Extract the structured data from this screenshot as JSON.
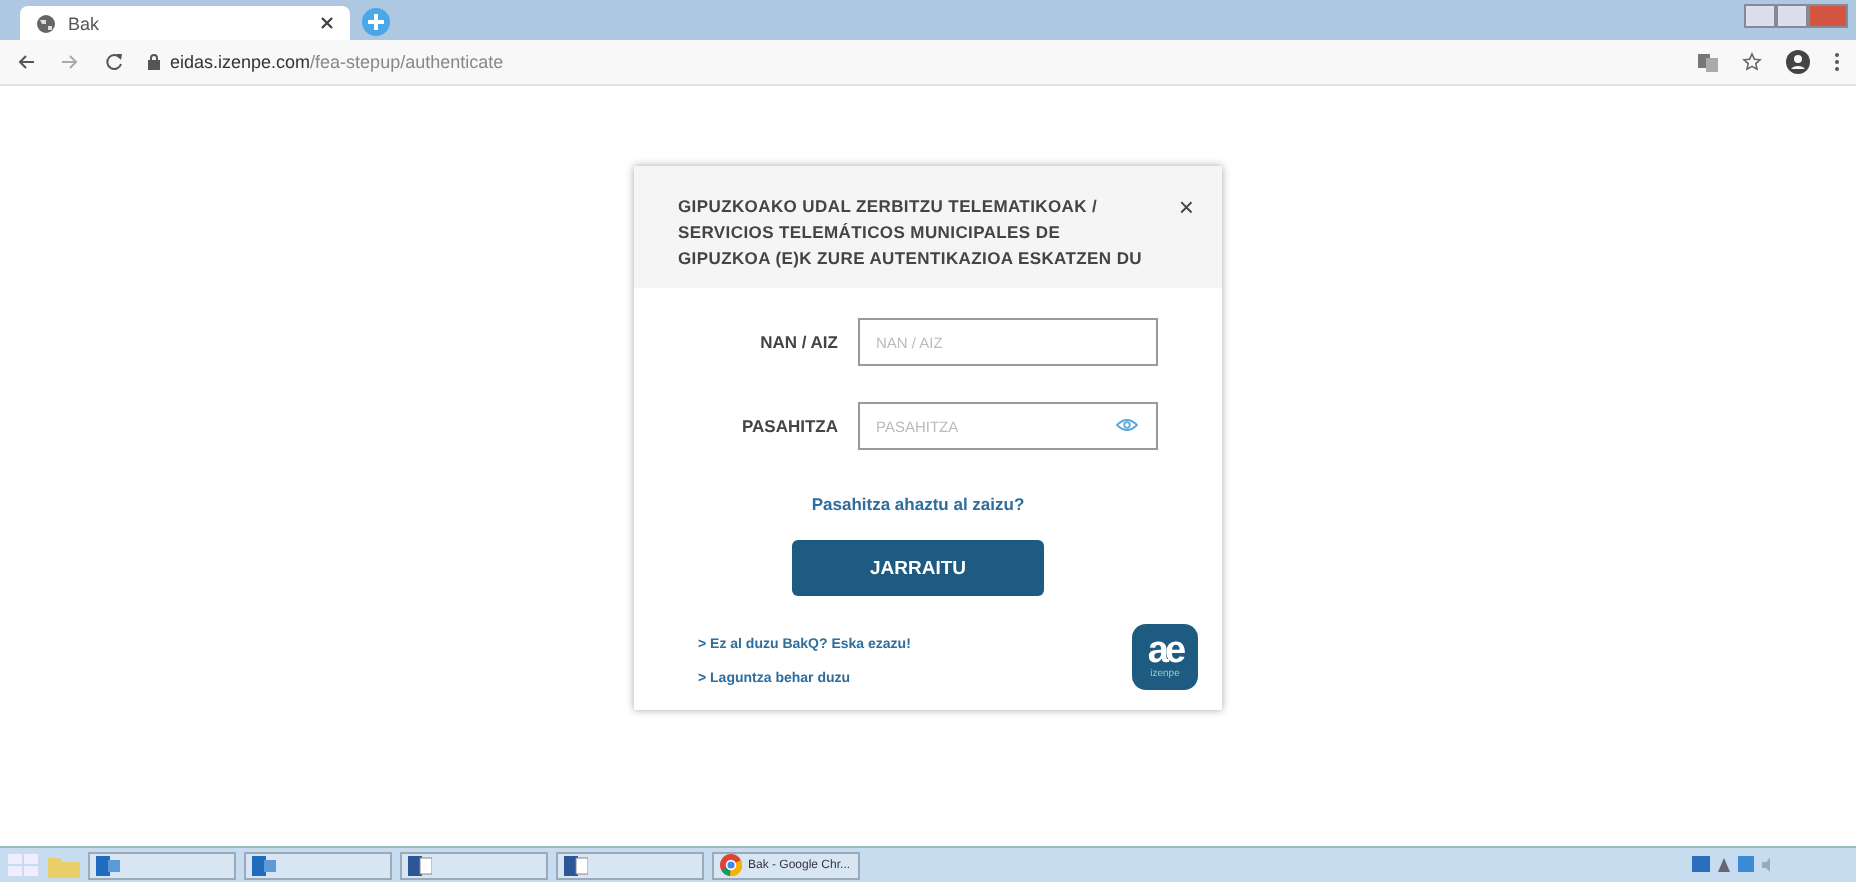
{
  "browser": {
    "tabs": [
      {
        "title": "Bak",
        "selected": true
      }
    ],
    "url_host": "eidas.izenpe.com",
    "url_path": "/fea-stepup/authenticate"
  },
  "dialog": {
    "title": "GIPUZKOAKO UDAL ZERBITZU TELEMATIKOAK / SERVICIOS TELEMÁTICOS MUNICIPALES DE GIPUZKOA  (E)K ZURE AUTENTIKAZIOA ESKATZEN DU",
    "close": "×",
    "fields": [
      {
        "kind": "text",
        "label": "NAN / AIZ",
        "placeholder": "NAN / AIZ"
      },
      {
        "kind": "password",
        "label": "PASAHITZA",
        "placeholder": "PASAHITZA"
      }
    ],
    "forgot_link": "Pasahitza ahaztu al zaizu?",
    "submit": "JARRAITU",
    "links": [
      "> Ez al duzu BakQ? Eska ezazu!",
      "> Laguntza behar duzu"
    ],
    "logo_mark": "ae",
    "logo_text": "izenpe"
  },
  "taskbar": {
    "items": [
      {
        "kind": "outlook"
      },
      {
        "kind": "outlook"
      },
      {
        "kind": "word"
      },
      {
        "kind": "word"
      },
      {
        "kind": "chrome",
        "label": "Bak - Google Chr..."
      }
    ]
  }
}
